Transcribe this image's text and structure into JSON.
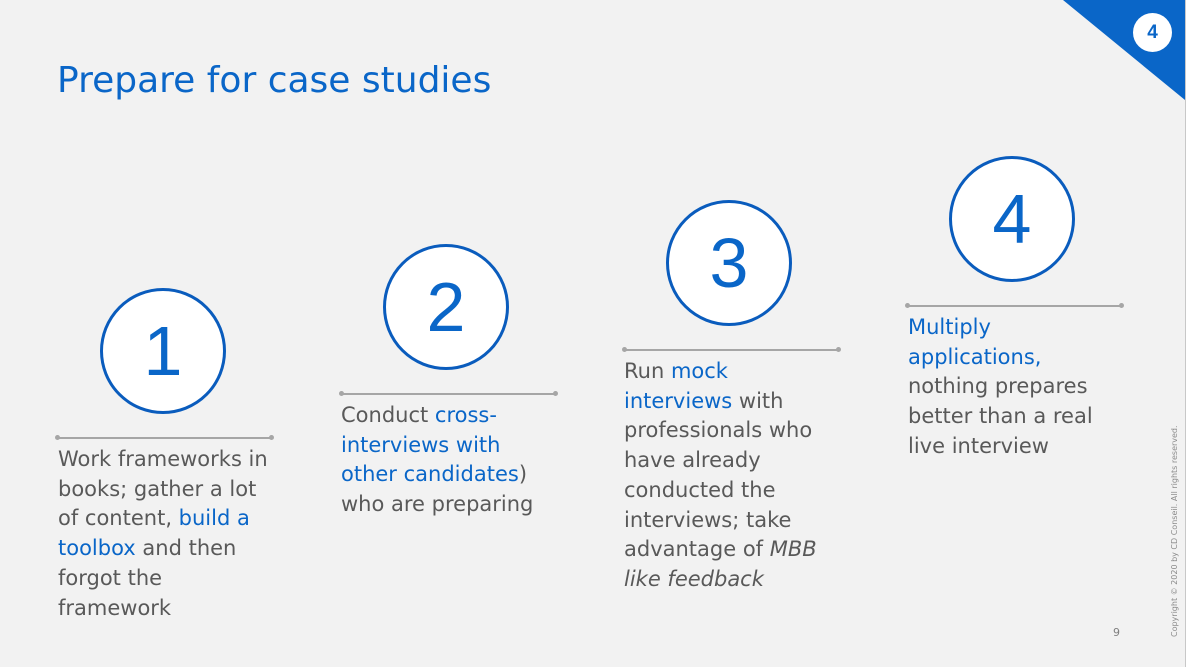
{
  "slide": {
    "title": "Prepare for case studies",
    "corner_badge": "4",
    "page_number": "9",
    "copyright": "Copyright © 2020 by CD Conseil. All rights reserved.",
    "colors": {
      "accent": "#0a66c8",
      "text": "#595959",
      "background": "#f2f2f2",
      "divider": "#a6a6a6"
    }
  },
  "steps": [
    {
      "number": "1",
      "segments": [
        {
          "text": "Work frameworks in books; gather a lot of content, ",
          "style": "normal"
        },
        {
          "text": "build a toolbox",
          "style": "highlight"
        },
        {
          "text": " and then forgot the framework",
          "style": "normal"
        }
      ]
    },
    {
      "number": "2",
      "segments": [
        {
          "text": "Conduct ",
          "style": "normal"
        },
        {
          "text": "cross-interviews with other candidates",
          "style": "highlight"
        },
        {
          "text": ") who are preparing",
          "style": "normal"
        }
      ]
    },
    {
      "number": "3",
      "segments": [
        {
          "text": "Run ",
          "style": "normal"
        },
        {
          "text": "mock interviews",
          "style": "highlight"
        },
        {
          "text": " with professionals who have already conducted the interviews; take advantage of ",
          "style": "normal"
        },
        {
          "text": "MBB like feedback",
          "style": "italic"
        }
      ]
    },
    {
      "number": "4",
      "segments": [
        {
          "text": "Multiply applications,",
          "style": "highlight"
        },
        {
          "text": " nothing prepares better than a real live interview",
          "style": "normal"
        }
      ]
    }
  ]
}
